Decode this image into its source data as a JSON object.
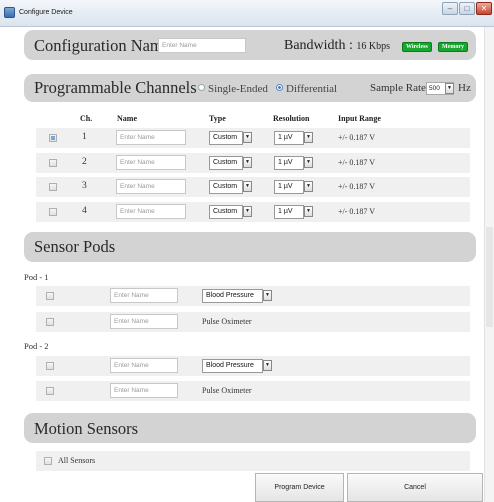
{
  "window": {
    "title": "Configure Device"
  },
  "config": {
    "name_label": "Configuration Name",
    "name_placeholder": "Enter Name",
    "bandwidth_label": "Bandwidth :",
    "bandwidth_value": "16 Kbps",
    "badges": [
      "Wireless",
      "Memory"
    ]
  },
  "programmable": {
    "title": "Programmable Channels",
    "mode_options": [
      "Single-Ended",
      "Differential"
    ],
    "selected_mode": "Differential",
    "sample_rate_label": "Sample Rate:",
    "sample_rate_value": "500",
    "sample_rate_unit": "Hz",
    "columns": [
      "Ch.",
      "Name",
      "Type",
      "Resolution",
      "Input Range"
    ],
    "rows": [
      {
        "checked": true,
        "ch": "1",
        "name_placeholder": "Enter Name",
        "type": "Custom",
        "resolution": "1 µV",
        "range": "+/- 0.187 V"
      },
      {
        "checked": false,
        "ch": "2",
        "name_placeholder": "Enter Name",
        "type": "Custom",
        "resolution": "1 µV",
        "range": "+/- 0.187 V"
      },
      {
        "checked": false,
        "ch": "3",
        "name_placeholder": "Enter Name",
        "type": "Custom",
        "resolution": "1 µV",
        "range": "+/- 0.187 V"
      },
      {
        "checked": false,
        "ch": "4",
        "name_placeholder": "Enter Name",
        "type": "Custom",
        "resolution": "1 µV",
        "range": "+/- 0.187 V"
      }
    ]
  },
  "sensor_pods": {
    "title": "Sensor Pods",
    "pods": [
      {
        "label": "Pod - 1",
        "rows": [
          {
            "name_placeholder": "Enter Name",
            "sensor": "Blood Pressure",
            "is_select": true
          },
          {
            "name_placeholder": "Enter Name",
            "sensor": "Pulse Oximeter",
            "is_select": false
          }
        ]
      },
      {
        "label": "Pod - 2",
        "rows": [
          {
            "name_placeholder": "Enter Name",
            "sensor": "Blood Pressure",
            "is_select": true
          },
          {
            "name_placeholder": "Enter Name",
            "sensor": "Pulse Oximeter",
            "is_select": false
          }
        ]
      }
    ]
  },
  "motion": {
    "title": "Motion Sensors",
    "all_sensors_label": "All Sensors"
  },
  "footer": {
    "program_label": "Program Device",
    "cancel_label": "Cancel"
  },
  "colors": {
    "badge_green": "#16a82d",
    "header_gray": "#d3d3d3",
    "row_gray": "#f0f0f0"
  }
}
